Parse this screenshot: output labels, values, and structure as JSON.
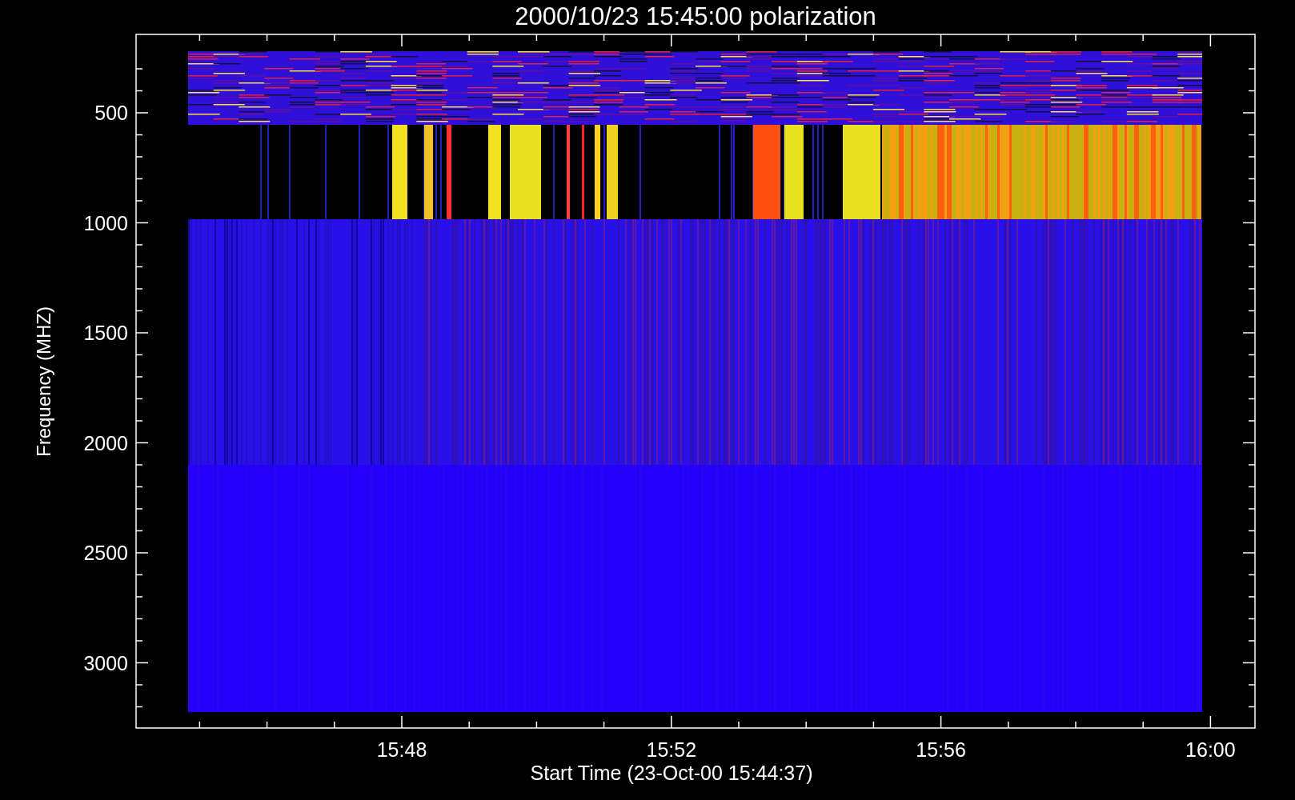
{
  "title": "2000/10/23 15:45:00 polarization",
  "y_axis": {
    "label": "Frequency (MHZ)",
    "ticks": [
      "500",
      "1000",
      "1500",
      "2000",
      "2500",
      "3000"
    ]
  },
  "x_axis": {
    "label": "Start Time (23-Oct-00 15:44:37)",
    "ticks": [
      "15:48",
      "15:52",
      "15:56",
      "16:00"
    ]
  }
}
